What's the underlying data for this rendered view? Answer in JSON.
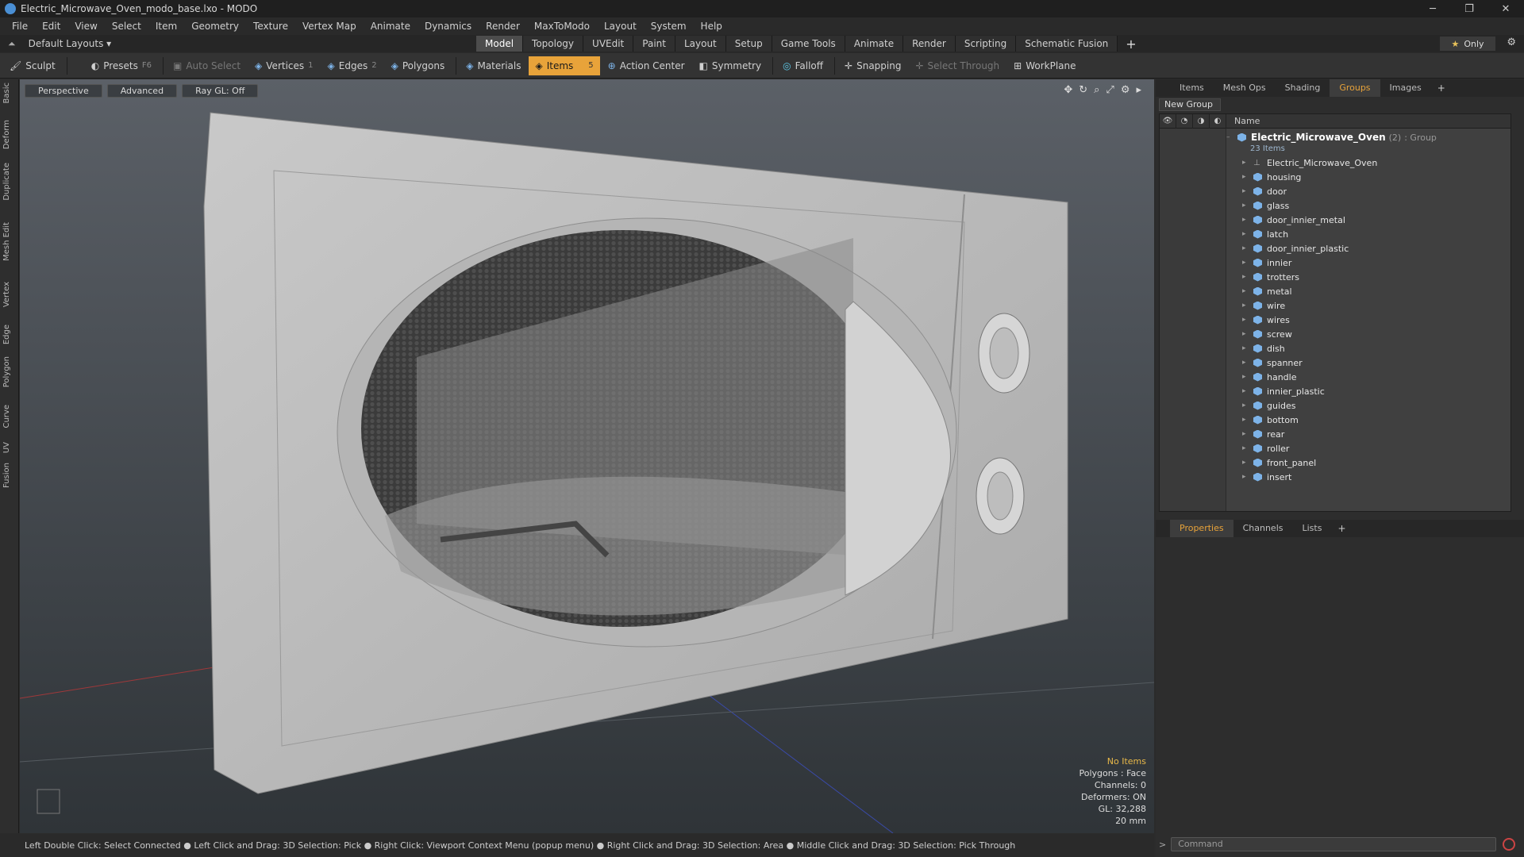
{
  "window": {
    "title": "Electric_Microwave_Oven_modo_base.lxo - MODO",
    "minimize": "─",
    "maximize": "❐",
    "close": "✕"
  },
  "menu": [
    "File",
    "Edit",
    "View",
    "Select",
    "Item",
    "Geometry",
    "Texture",
    "Vertex Map",
    "Animate",
    "Dynamics",
    "Render",
    "MaxToModo",
    "Layout",
    "System",
    "Help"
  ],
  "layout_selector": "Default Layouts ▾",
  "tabs": [
    {
      "label": "Model",
      "active": true
    },
    {
      "label": "Topology"
    },
    {
      "label": "UVEdit"
    },
    {
      "label": "Paint"
    },
    {
      "label": "Layout"
    },
    {
      "label": "Setup"
    },
    {
      "label": "Game Tools"
    },
    {
      "label": "Animate"
    },
    {
      "label": "Render"
    },
    {
      "label": "Scripting"
    },
    {
      "label": "Schematic Fusion"
    }
  ],
  "only_button": {
    "star": "★",
    "label": "Only"
  },
  "toolbar": {
    "sculpt": "Sculpt",
    "presets": "Presets",
    "presets_key": "F6",
    "auto_select": "Auto Select",
    "vertices": "Vertices",
    "vertices_key": "1",
    "edges": "Edges",
    "edges_key": "2",
    "polygons": "Polygons",
    "materials": "Materials",
    "items": "Items",
    "items_key": "5",
    "action_center": "Action Center",
    "symmetry": "Symmetry",
    "falloff": "Falloff",
    "snapping": "Snapping",
    "select_through": "Select Through",
    "workplane": "WorkPlane"
  },
  "left_tabs": [
    "Basic",
    "Deform",
    "Duplicate",
    "Mesh Edit",
    "Vertex",
    "Edge",
    "Polygon",
    "Curve",
    "UV",
    "Fusion"
  ],
  "viewport": {
    "view": "Perspective",
    "shading": "Advanced",
    "raygl": "Ray GL: Off",
    "info": {
      "no_items": "No Items",
      "polygons": "Polygons : Face",
      "channels": "Channels: 0",
      "deformers": "Deformers: ON",
      "gl": "GL: 32,288",
      "scale": "20 mm"
    }
  },
  "status": "Left Double Click: Select Connected ● Left Click and Drag: 3D Selection: Pick ● Right Click: Viewport Context Menu (popup menu) ● Right Click and Drag: 3D Selection: Area ● Middle Click and Drag: 3D Selection: Pick Through",
  "panel_tabs": [
    {
      "label": "Items"
    },
    {
      "label": "Mesh Ops"
    },
    {
      "label": "Shading"
    },
    {
      "label": "Groups",
      "active": true
    },
    {
      "label": "Images"
    }
  ],
  "new_group": "New Group",
  "list_header": "Name",
  "group": {
    "name": "Electric_Microwave_Oven",
    "count": "(2)",
    "type": ": Group",
    "sub": "23 Items"
  },
  "items": [
    "Electric_Microwave_Oven",
    "housing",
    "door",
    "glass",
    "door_innier_metal",
    "latch",
    "door_innier_plastic",
    "innier",
    "trotters",
    "metal",
    "wire",
    "wires",
    "screw",
    "dish",
    "spanner",
    "handle",
    "innier_plastic",
    "guides",
    "bottom",
    "rear",
    "roller",
    "front_panel",
    "insert"
  ],
  "props_tabs": [
    {
      "label": "Properties",
      "active": true
    },
    {
      "label": "Channels"
    },
    {
      "label": "Lists"
    }
  ],
  "command_placeholder": "Command"
}
